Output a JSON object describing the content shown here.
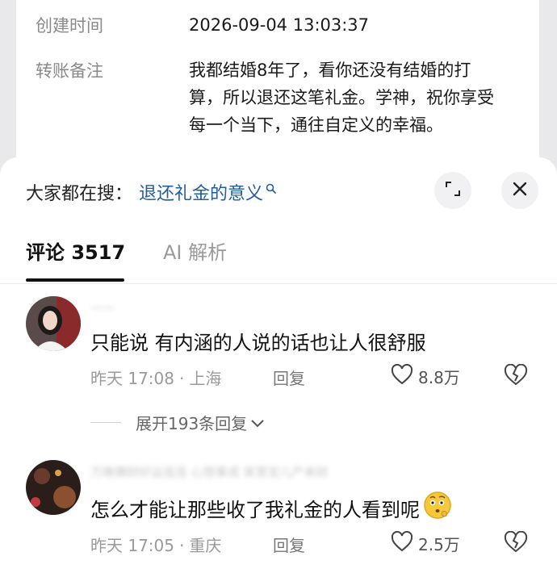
{
  "detail": {
    "time_label": "创建时间",
    "time_value": "2026-09-04 13:03:37",
    "note_label": "转账备注",
    "note_lines": [
      "我都结婚8年了，看你还没有结婚的打",
      "算，所以退还这笔礼金。学神，祝你享受",
      "每一个当下，通往自定义的幸福。"
    ]
  },
  "search": {
    "prefix": "大家都在搜：",
    "query": "退还礼金的意义"
  },
  "tabs": {
    "comments": "评论 3517",
    "ai": "AI 解析"
  },
  "comments": [
    {
      "username": "一一",
      "text": "只能说 有内涵的人说的话也让人很舒服",
      "time": "昨天 17:08",
      "location": "上海",
      "reply_label": "回复",
      "likes": "8.8万",
      "expand_label": "展开193条回复"
    },
    {
      "username": "万晚横财好运连连 心想事成 家里宝儿产来财",
      "text": "怎么才能让那些收了我礼金的人看到呢",
      "time": "昨天 17:05",
      "location": "重庆",
      "reply_label": "回复",
      "likes": "2.5万"
    }
  ],
  "icons": {
    "search": "search-icon",
    "expand": "expand-icon",
    "close": "close-icon",
    "like": "heart-icon",
    "dislike": "broken-heart-icon",
    "chevron": "chevron-down-icon",
    "emoji": "thinking-face-emoji"
  },
  "colors": {
    "link": "#1f5d9c",
    "muted": "#9a9a9a",
    "tab_active": "#111111"
  }
}
